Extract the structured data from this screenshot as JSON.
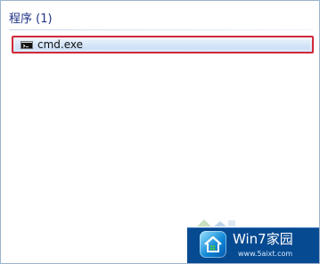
{
  "section": {
    "title": "程序 (1)"
  },
  "results": [
    {
      "label": "cmd.exe",
      "icon": "command-prompt-icon"
    }
  ],
  "watermark": {
    "brand": "Win7家园",
    "url": "www.5aixt.com"
  },
  "colors": {
    "section_title": "#1e3287",
    "selection_border": "#d3293a",
    "selection_fill": "#d5e6f8",
    "watermark_bg": "#064a91"
  }
}
